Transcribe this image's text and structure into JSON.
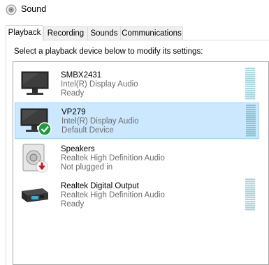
{
  "window": {
    "title": "Sound",
    "icon": "speaker-icon"
  },
  "tabs": [
    {
      "label": "Playback",
      "active": true
    },
    {
      "label": "Recording",
      "active": false
    },
    {
      "label": "Sounds",
      "active": false
    },
    {
      "label": "Communications",
      "active": false
    }
  ],
  "playback": {
    "instruction": "Select a playback device below to modify its settings:",
    "devices": [
      {
        "name": "SMBX2431",
        "driver": "Intel(R) Display Audio",
        "status": "Ready",
        "icon": "monitor-icon",
        "selected": false
      },
      {
        "name": "VP279",
        "driver": "Intel(R) Display Audio",
        "status": "Default Device",
        "icon": "monitor-default-icon",
        "selected": true
      },
      {
        "name": "Speakers",
        "driver": "Realtek High Definition Audio",
        "status": "Not plugged in",
        "icon": "speaker-unplugged-icon",
        "selected": false
      },
      {
        "name": "Realtek Digital Output",
        "driver": "Realtek High Definition Audio",
        "status": "Ready",
        "icon": "digital-output-icon",
        "selected": false
      }
    ]
  },
  "colors": {
    "selection_bg": "#cce8ff",
    "selection_border": "#99d1ff",
    "meter": "#a8d4dc",
    "meter_active": "#89c3d0",
    "default_check": "#1e9b3a",
    "unplugged_arrow": "#d1151b"
  }
}
